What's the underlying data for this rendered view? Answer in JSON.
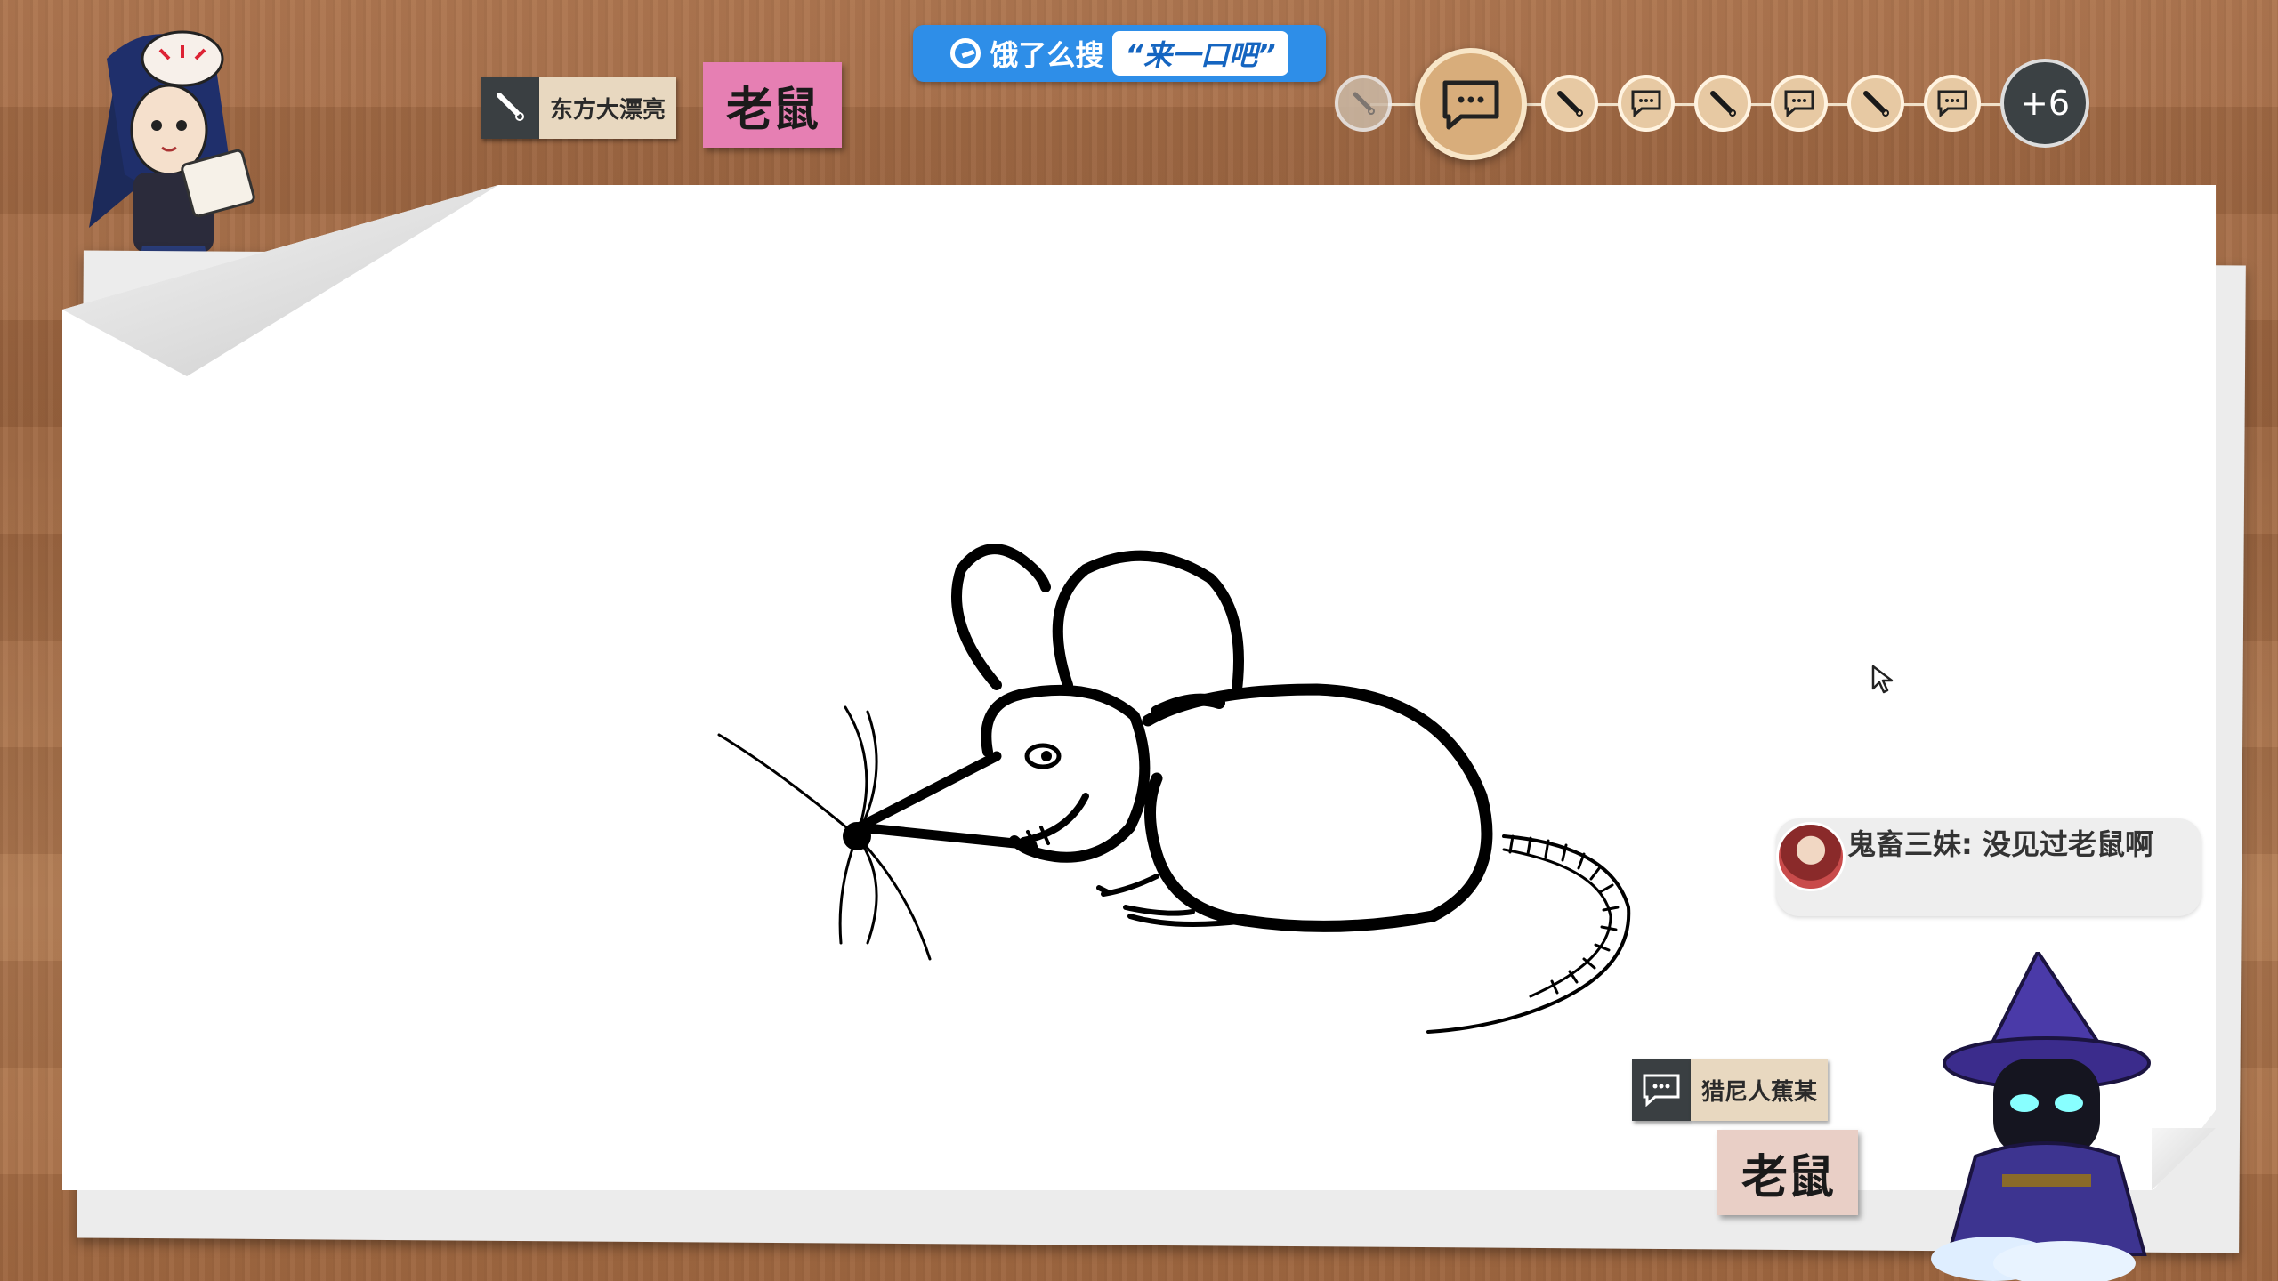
{
  "ad": {
    "brand": "饿了么搜",
    "quote": "“来一口吧”"
  },
  "drawer": {
    "name": "东方大漂亮",
    "word": "老鼠",
    "word_color": "#e67fb3"
  },
  "players": {
    "more_count": "+6",
    "nodes": [
      "brush",
      "chat",
      "brush",
      "chat",
      "brush",
      "chat",
      "brush",
      "chat"
    ]
  },
  "chat": {
    "speaker": "鬼畜三妹",
    "message": "没见过老鼠啊"
  },
  "guesser": {
    "name": "猎尼人蕉某",
    "word": "老鼠",
    "word_color": "#e9cfc6"
  },
  "colors": {
    "ad_blue": "#2e8ee8",
    "dark_tag": "#3a3f42",
    "player_node": "#e7c9a3",
    "paper": "#ffffff"
  },
  "icons": {
    "brush": "brush-icon",
    "chat": "chat-icon",
    "cursor": "cursor-icon"
  }
}
